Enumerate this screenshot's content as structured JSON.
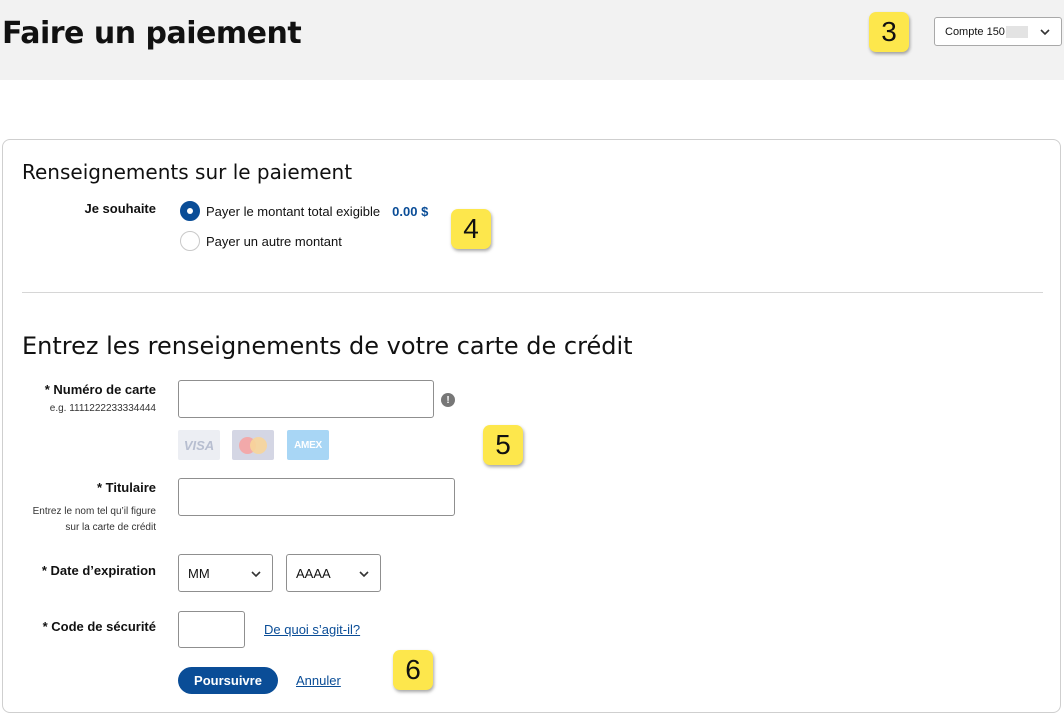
{
  "header": {
    "title": "Faire un paiement",
    "account_label": "Compte 150",
    "marker": "3"
  },
  "payment": {
    "section_title": "Renseignements sur le paiement",
    "want_label": "Je souhaite",
    "options": [
      {
        "label": "Payer le montant total exigible",
        "amount": "0.00 $",
        "selected": true
      },
      {
        "label": "Payer un autre montant",
        "selected": false
      }
    ],
    "marker": "4"
  },
  "card": {
    "section_title": "Entrez les renseignements de votre carte de crédit",
    "card_number": {
      "label": "* Numéro de carte",
      "hint": "e.g. 1111222233334444",
      "value": ""
    },
    "info_glyph": "!",
    "logos": [
      "VISA",
      "MasterCard",
      "AMEX"
    ],
    "marker5": "5",
    "holder": {
      "label": "* Titulaire",
      "hint_line1": "Entrez le nom tel qu’il figure",
      "hint_line2": "sur la carte de crédit",
      "value": ""
    },
    "expiry": {
      "label": "* Date d’expiration",
      "month": "MM",
      "year": "AAAA"
    },
    "security": {
      "label": "* Code de sécurité",
      "help_link": "De quoi s’agit-il?",
      "value": ""
    },
    "continue_label": "Poursuivre",
    "cancel_label": "Annuler",
    "marker6": "6"
  },
  "colors": {
    "accent": "#0a4d97",
    "marker": "#fde74c",
    "header_bg": "#f2f2f2"
  },
  "icons": [
    "chevron-down-icon",
    "info-icon",
    "visa-logo",
    "mastercard-logo",
    "amex-logo"
  ]
}
